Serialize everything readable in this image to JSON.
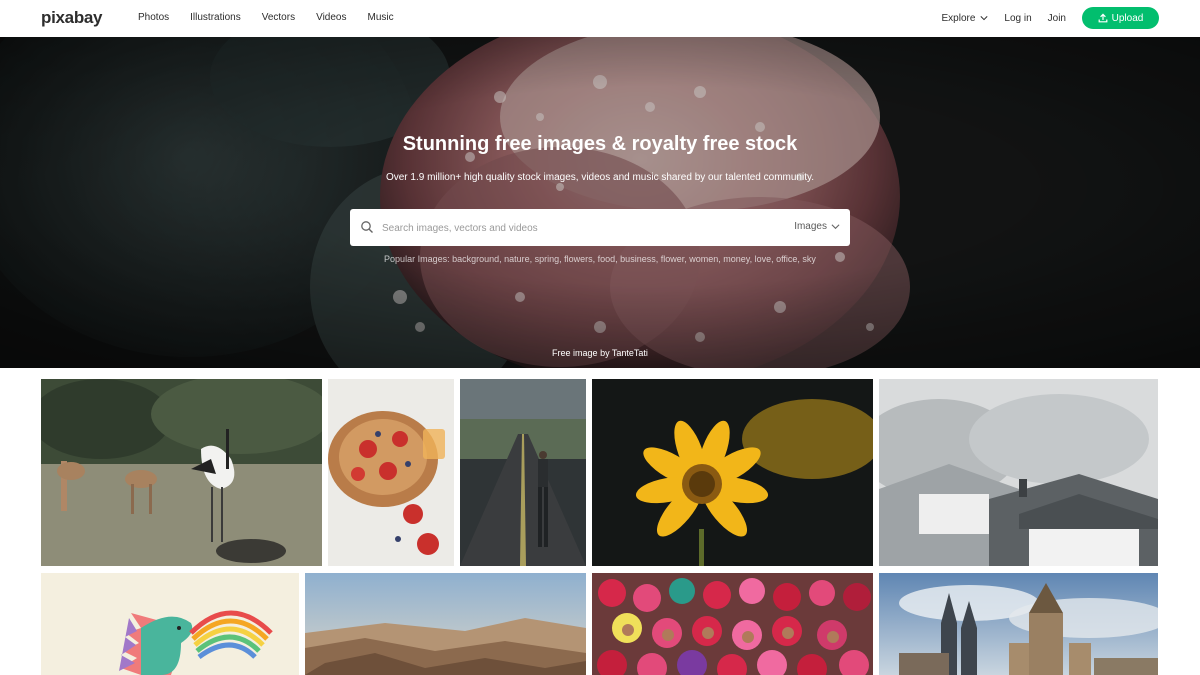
{
  "header": {
    "logo": "pixabay",
    "nav": [
      "Photos",
      "Illustrations",
      "Vectors",
      "Videos",
      "Music"
    ],
    "explore_label": "Explore",
    "login_label": "Log in",
    "join_label": "Join",
    "upload_label": "Upload"
  },
  "hero": {
    "title": "Stunning free images & royalty free stock",
    "subtitle": "Over 1.9 million+ high quality stock images, videos and music shared by our talented community.",
    "search_placeholder": "Search images, vectors and videos",
    "search_type": "Images",
    "popular": "Popular Images: background, nature, spring, flowers, food, business, flower, women, money, love, office, sky",
    "credit": "Free image by TanteTati"
  },
  "colors": {
    "brand": "#02be6e",
    "text": "#2d2d2d"
  }
}
